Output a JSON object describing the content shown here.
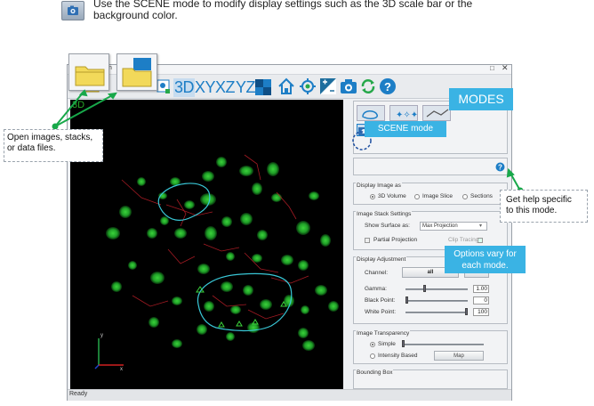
{
  "header": {
    "instruction": "Use the SCENE mode to modify display settings such as the 3D scale bar or the background color."
  },
  "window": {
    "menu_tail": "n",
    "min_glyph": "□",
    "close_glyph": "✕",
    "toolbar": {
      "view_3d": "3D",
      "view_xy": "XY",
      "view_xz": "XZ",
      "view_yz": "YZ"
    },
    "viewport": {
      "label": "3D",
      "axis_y": "y",
      "axis_x": "x"
    },
    "status": "Ready"
  },
  "panel": {
    "modes_tooltip": "MODES",
    "scene_tooltip": "SCENE mode",
    "display_image_as": {
      "title": "Display Image as",
      "options": [
        "3D Volume",
        "Image Slice",
        "Sections"
      ],
      "selected": "3D Volume"
    },
    "image_stack_settings": {
      "title": "Image Stack Settings",
      "show_surface_label": "Show Surface as:",
      "show_surface_value": "Max Projection",
      "partial_projection": "Partial Projection",
      "clip_tracing": "Clip Tracing"
    },
    "display_adjustment": {
      "title": "Display Adjustment",
      "channel_label": "Channel:",
      "channel_value": "all",
      "gamma_label": "Gamma:",
      "gamma_value": "1.00",
      "gamma_level": 0.3,
      "black_label": "Black Point:",
      "black_value": "0",
      "black_level": 0.0,
      "white_label": "White Point:",
      "white_value": "100",
      "white_level": 1.0
    },
    "image_transparency": {
      "title": "Image Transparency",
      "simple": "Simple",
      "intensity_based": "Intensity Based",
      "map_button": "Map"
    },
    "bounding_box": {
      "title": "Bounding Box"
    }
  },
  "callouts": {
    "open_files": "Open images, stacks, or data files.",
    "get_help": "Get help specific to this mode.",
    "options_vary": "Options vary for each mode."
  },
  "colors": {
    "accent_blue": "#1d7ec6",
    "callout_blue": "#3ab3e4",
    "arrow_green": "#18a84a",
    "nuclei_green": "#3bd23b",
    "trace_cyan": "#39c7d6"
  }
}
